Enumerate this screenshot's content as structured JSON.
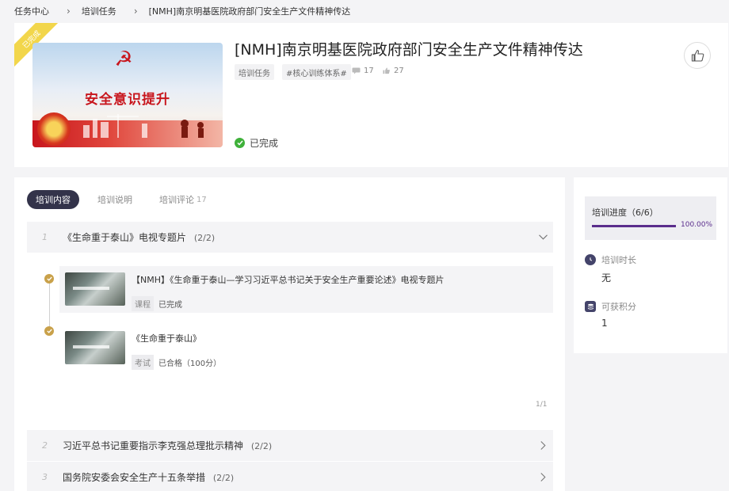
{
  "breadcrumb": {
    "items": [
      "任务中心",
      "培训任务",
      "[NMH]南京明基医院政府部门安全生产文件精神传达"
    ]
  },
  "header": {
    "ribbon": "已完成",
    "cover_text": "安全意识提升",
    "title": "[NMH]南京明基医院政府部门安全生产文件精神传达",
    "tags": [
      "培训任务",
      "#核心训练体系#"
    ],
    "comment_count": "17",
    "like_count": "27",
    "status": "已完成"
  },
  "tabs": {
    "content": "培训内容",
    "description": "培训说明",
    "comments": "培训评论",
    "comments_count": "17"
  },
  "sections": [
    {
      "num": "1",
      "title": "《生命重于泰山》电视专题片",
      "progress": "(2/2)",
      "items": [
        {
          "title": "【NMH】《生命重于泰山—学习习近平总书记关于安全生产重要论述》电视专题片",
          "type": "课程",
          "status": "已完成"
        },
        {
          "title": "《生命重于泰山》",
          "type": "考试",
          "status": "已合格（100分）"
        }
      ],
      "pager": "1/1"
    },
    {
      "num": "2",
      "title": "习近平总书记重要指示李克强总理批示精神",
      "progress": "(2/2)"
    },
    {
      "num": "3",
      "title": "国务院安委会安全生产十五条举措",
      "progress": "(2/2)"
    }
  ],
  "side": {
    "progress_label": "培训进度（6/6）",
    "progress_pct": "100.00%",
    "progress_value": 1.0,
    "duration_label": "培训时长",
    "duration_value": "无",
    "points_label": "可获积分",
    "points_value": "1"
  },
  "colors": {
    "accent": "#5a2d8c",
    "active_tab": "#33334a",
    "success": "#3fb13a",
    "ribbon": "#f2d64b",
    "timeline_dot": "#c9a14a"
  }
}
